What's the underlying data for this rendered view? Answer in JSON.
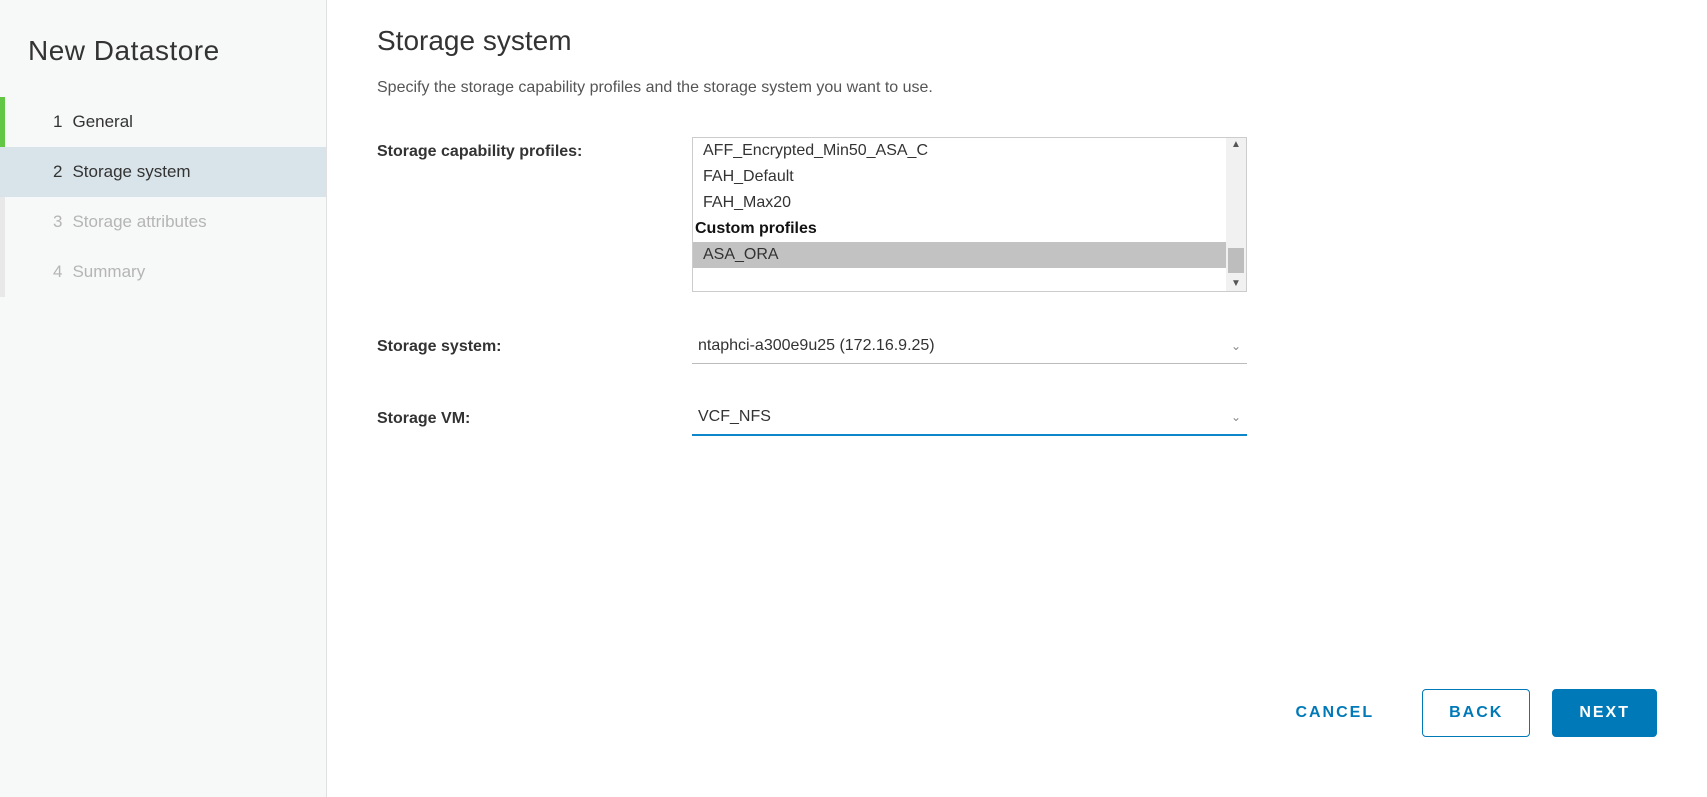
{
  "wizard": {
    "title": "New Datastore",
    "steps": [
      {
        "num": "1",
        "label": "General",
        "state": "completed"
      },
      {
        "num": "2",
        "label": "Storage system",
        "state": "active"
      },
      {
        "num": "3",
        "label": "Storage attributes",
        "state": "disabled"
      },
      {
        "num": "4",
        "label": "Summary",
        "state": "disabled"
      }
    ]
  },
  "page": {
    "title": "Storage system",
    "subtitle": "Specify the storage capability profiles and the storage system you want to use."
  },
  "form": {
    "profiles_label": "Storage capability profiles:",
    "profiles_options": [
      {
        "text": "AFF_Encrypted_Min50_ASA_C",
        "type": "option",
        "selected": false
      },
      {
        "text": "FAH_Default",
        "type": "option",
        "selected": false
      },
      {
        "text": "FAH_Max20",
        "type": "option",
        "selected": false
      },
      {
        "text": "Custom profiles",
        "type": "group",
        "selected": false
      },
      {
        "text": "ASA_ORA",
        "type": "option",
        "selected": true
      }
    ],
    "system_label": "Storage system:",
    "system_value": "ntaphci-a300e9u25 (172.16.9.25)",
    "vm_label": "Storage VM:",
    "vm_value": "VCF_NFS"
  },
  "buttons": {
    "cancel": "CANCEL",
    "back": "BACK",
    "next": "NEXT"
  }
}
